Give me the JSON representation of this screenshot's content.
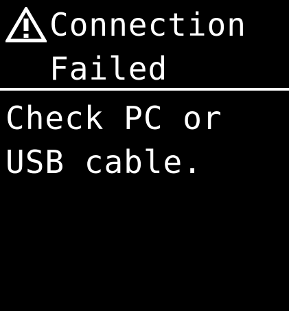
{
  "screen": {
    "icon": "warning-triangle-icon",
    "title_line1": "Connection",
    "title_line2": "Failed",
    "message_line1": "Check PC or",
    "message_line2": "USB cable.",
    "colors": {
      "background": "#000000",
      "foreground": "#ffffff"
    }
  }
}
